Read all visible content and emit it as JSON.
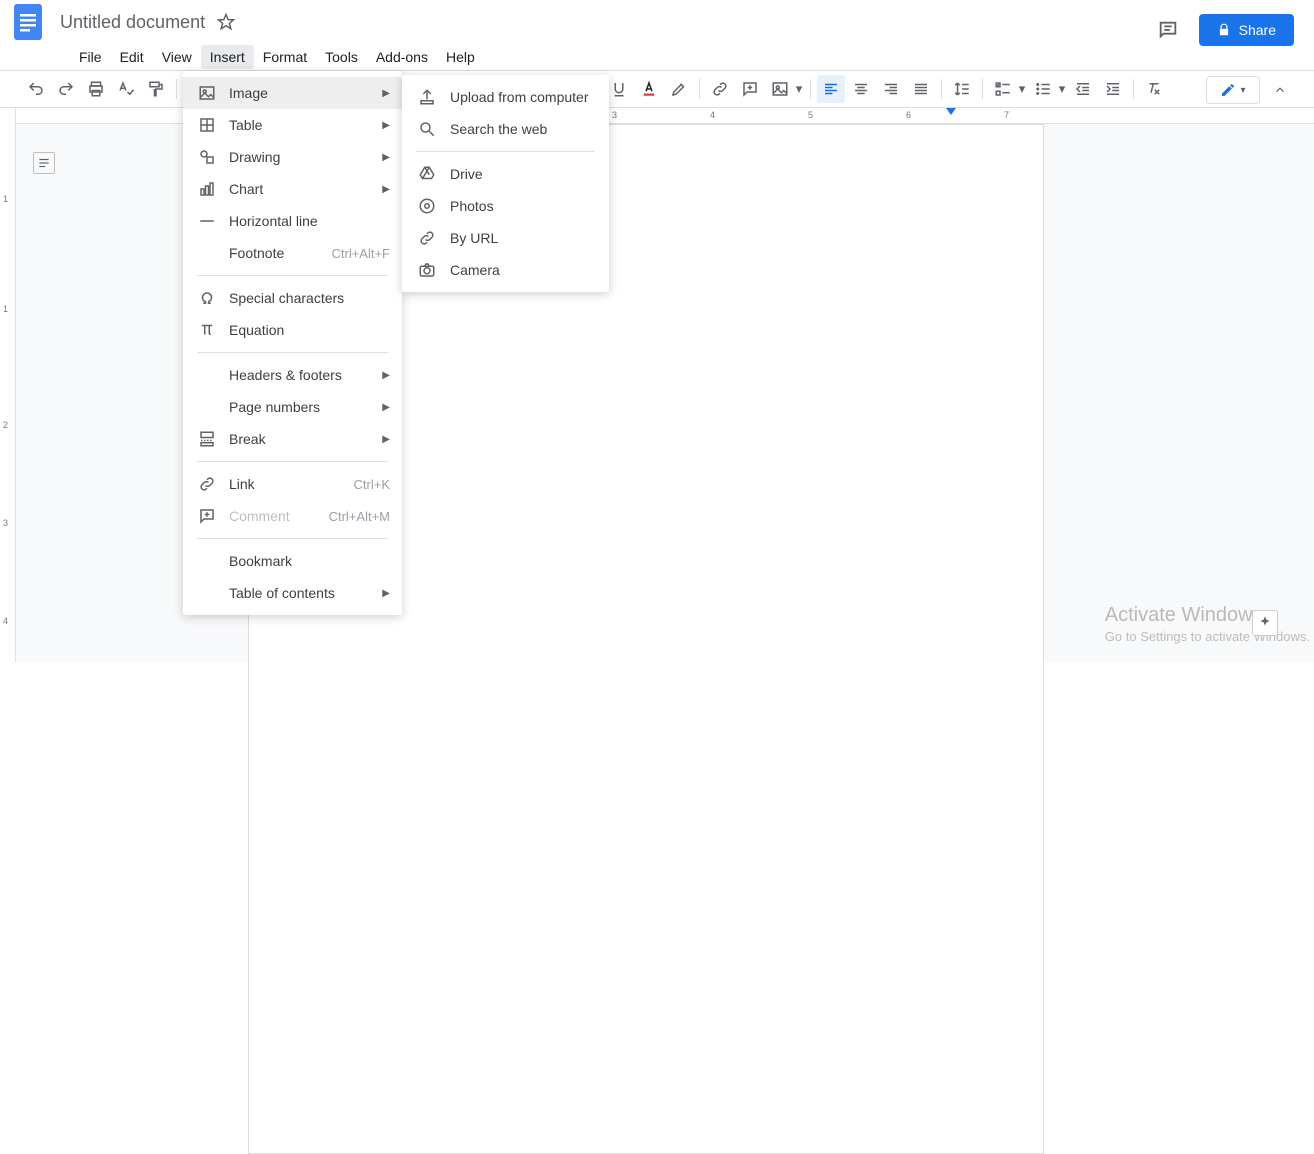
{
  "header": {
    "title": "Untitled document",
    "share_label": "Share"
  },
  "menubar": [
    "File",
    "Edit",
    "View",
    "Insert",
    "Format",
    "Tools",
    "Add-ons",
    "Help"
  ],
  "menubar_active_index": 3,
  "insert_menu": [
    {
      "icon": "image",
      "label": "Image",
      "sub": true,
      "hl": true
    },
    {
      "icon": "table",
      "label": "Table",
      "sub": true
    },
    {
      "icon": "drawing",
      "label": "Drawing",
      "sub": true
    },
    {
      "icon": "chart",
      "label": "Chart",
      "sub": true
    },
    {
      "icon": "hr",
      "label": "Horizontal line"
    },
    {
      "icon": "",
      "label": "Footnote",
      "short": "Ctrl+Alt+F"
    },
    {
      "sep": true
    },
    {
      "icon": "omega",
      "label": "Special characters"
    },
    {
      "icon": "pi",
      "label": "Equation"
    },
    {
      "sep": true
    },
    {
      "icon": "",
      "label": "Headers & footers",
      "sub": true
    },
    {
      "icon": "",
      "label": "Page numbers",
      "sub": true
    },
    {
      "icon": "break",
      "label": "Break",
      "sub": true
    },
    {
      "sep": true
    },
    {
      "icon": "link",
      "label": "Link",
      "short": "Ctrl+K"
    },
    {
      "icon": "comment",
      "label": "Comment",
      "short": "Ctrl+Alt+M",
      "disabled": true
    },
    {
      "sep": true
    },
    {
      "icon": "",
      "label": "Bookmark"
    },
    {
      "icon": "",
      "label": "Table of contents",
      "sub": true
    }
  ],
  "image_submenu": [
    {
      "icon": "upload",
      "label": "Upload from computer"
    },
    {
      "icon": "search",
      "label": "Search the web"
    },
    {
      "sep": true
    },
    {
      "icon": "drive",
      "label": "Drive"
    },
    {
      "icon": "photos",
      "label": "Photos"
    },
    {
      "icon": "url",
      "label": "By URL"
    },
    {
      "icon": "camera",
      "label": "Camera"
    }
  ],
  "ruler_h": [
    "3",
    "4",
    "5",
    "6",
    "7"
  ],
  "ruler_v": [
    "1",
    "1",
    "2",
    "3",
    "4"
  ],
  "watermark": {
    "line1": "Activate Windows",
    "line2": "Go to Settings to activate Windows."
  }
}
